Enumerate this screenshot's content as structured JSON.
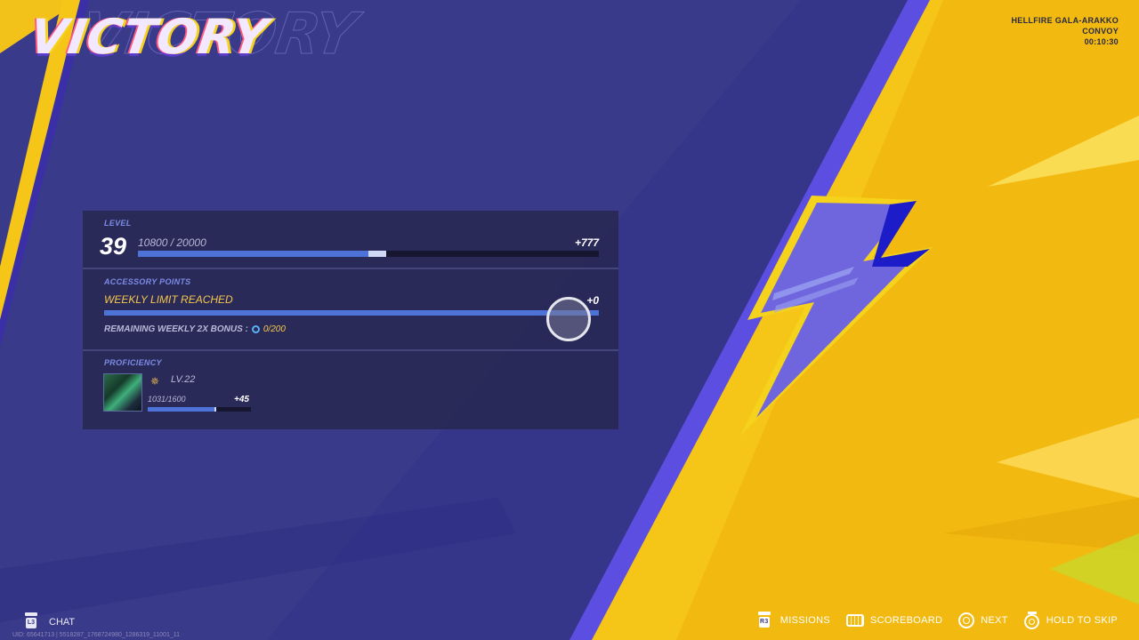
{
  "title": "VICTORY",
  "match_info": {
    "line1": "HELLFIRE GALA-ARAKKO",
    "line2": "CONVOY",
    "time": "00:10:30"
  },
  "level": {
    "label": "LEVEL",
    "value": "39",
    "xp_text": "10800 / 20000",
    "gain": "+777",
    "progress_start": 0.5,
    "progress_after": 0.539
  },
  "accessory": {
    "label": "ACCESSORY POINTS",
    "status": "WEEKLY LIMIT REACHED",
    "gain": "+0",
    "progress": 1.0,
    "bonus_label": "REMAINING WEEKLY 2X BONUS :",
    "bonus_value": "0/200"
  },
  "proficiency": {
    "label": "PROFICIENCY",
    "level": "LV.22",
    "xp_text": "1031/1600",
    "gain": "+45",
    "progress": 0.644,
    "portrait_icon": "hero-portrait",
    "rank_icon": "rank-icon"
  },
  "footer": {
    "chat_label": "CHAT",
    "chat_button": "L3",
    "uid_text": "UID: 65641713 | 5518287_1768724980_1286319_11001_11",
    "controls": [
      {
        "label": "MISSIONS",
        "icon": "r3-button-icon",
        "key": "R3"
      },
      {
        "label": "SCOREBOARD",
        "icon": "keyboard-icon"
      },
      {
        "label": "NEXT",
        "icon": "circle-button-icon"
      },
      {
        "label": "HOLD TO SKIP",
        "icon": "hold-circle-icon"
      }
    ]
  },
  "colors": {
    "bg_purple": "#3a3a8a",
    "accent_yellow": "#f5c518",
    "bar_blue": "#4d72d8",
    "gold_text": "#f6c84a"
  }
}
